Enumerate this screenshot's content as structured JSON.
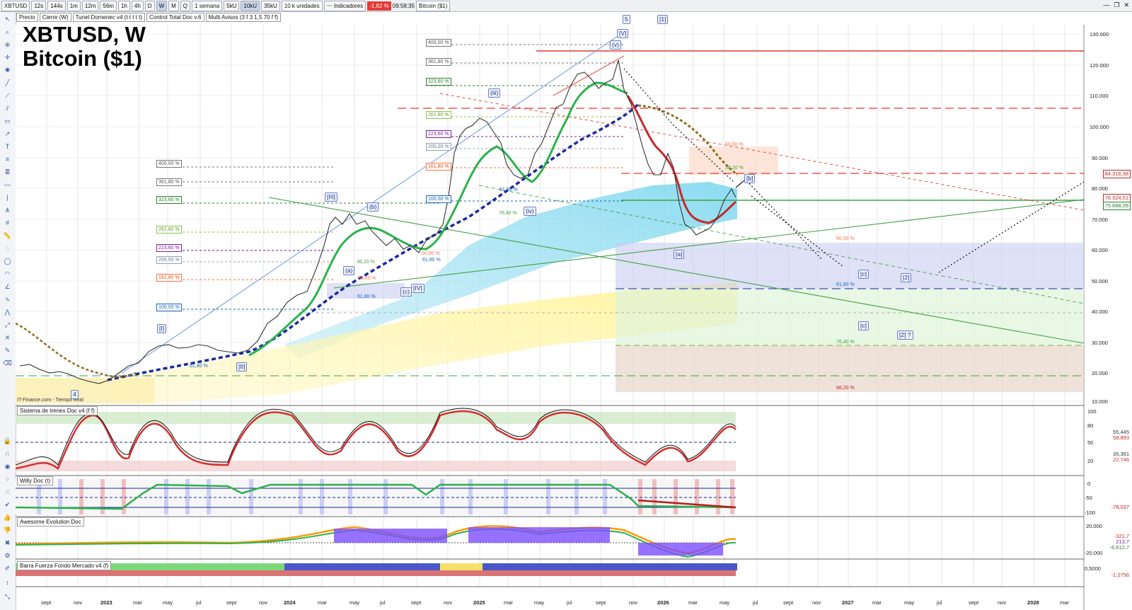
{
  "toolbar": {
    "symbol": "XBTUSD",
    "intervals": [
      "12s",
      "144s",
      "1m",
      "12m",
      "56m",
      "1h",
      "4h",
      "D",
      "W",
      "M",
      "Q"
    ],
    "active_interval": "W",
    "range": "1 semana",
    "units": [
      "5kU",
      "10kU",
      "35kU"
    ],
    "active_unit": "10kU",
    "unit_count": "10 k unidades",
    "indicators_label": "Indicadores",
    "change": "-1,82 %",
    "time": "09:58:35",
    "instrument": "Bitcoin ($1)"
  },
  "legend": [
    "Precio",
    "Cierre (W)",
    "Tunel Domenec v4 (t t t t t)",
    "Control Total Doc v.6",
    "Multi Avisos (3 f 3 1,5 70 f f)"
  ],
  "title": {
    "line1": "XBTUSD, W",
    "line2": "Bitcoin ($1)"
  },
  "source_note": "IT-Finance.com - Tiempo Real",
  "price_axis": [
    "130.000",
    "120.000",
    "110.000",
    "100.000",
    "90.000",
    "80.000",
    "70.000",
    "60.000",
    "50.000",
    "40.000",
    "30.000",
    "20.000",
    "10.000"
  ],
  "price_tags": [
    {
      "text": "84.316,38",
      "color": "#c62828",
      "bg": "#ffffff"
    },
    {
      "text": "76.324,51",
      "color": "#c62828",
      "bg": "#ffffff"
    },
    {
      "text": "75.688,09",
      "color": "#2e7d32",
      "bg": "#ffffff"
    }
  ],
  "time_axis": [
    "sept",
    "nov",
    "2023",
    "mar",
    "may",
    "jul",
    "sept",
    "nov",
    "2024",
    "mar",
    "may",
    "jul",
    "sept",
    "nov",
    "2025",
    "mar",
    "may",
    "jul",
    "sept",
    "nov",
    "2026",
    "mar",
    "may",
    "jul",
    "sept",
    "nov",
    "2027",
    "mar",
    "may",
    "jul",
    "sept",
    "nov",
    "2028",
    "mar"
  ],
  "waves": [
    "[1]",
    "5",
    "[V]",
    "(v)",
    "(iii)",
    "(iv)",
    "[III]",
    "(b)",
    "(a)",
    "(c)",
    "[IV]",
    "[I]",
    "[II]",
    "4",
    "[a]",
    "[b]",
    "[c]",
    "[2]",
    "[c]",
    "[2] ?"
  ],
  "fib_left": [
    "400,00 %",
    "361,80 %",
    "323,60 %",
    "261,80 %",
    "223,60 %",
    "200,00 %",
    "161,80 %",
    "100,00 %"
  ],
  "fib_mid": [
    "400,00 %",
    "361,80 %",
    "323,60 %",
    "261,80 %",
    "223,60 %",
    "200,00 %",
    "161,80 %",
    "100,00 %"
  ],
  "retrace_labels": [
    "38,20 %",
    "50,00 %",
    "61,80 %",
    "61,80 %",
    "50,00 %",
    "61,80 %",
    "76,40 %",
    "50,00 %",
    "61,80 %",
    "76,40 %",
    "88,20 %",
    "50,00 %",
    "38,20 %",
    "61,80 %"
  ],
  "panels": [
    {
      "label": "Sistema de trenes Doc v4 (f f)",
      "axis": [
        "100",
        "80",
        "50",
        "20"
      ],
      "tags": [
        "55,445",
        "58,893",
        "35,391",
        "22,746"
      ]
    },
    {
      "label": "Willy Doc (t)",
      "axis": [
        "0",
        "-50",
        "-100"
      ],
      "tags": [
        "-78,037"
      ]
    },
    {
      "label": "Awesome Evolution Doc",
      "axis": [
        "20.000",
        "-20.000"
      ],
      "tags": [
        "-321,7",
        "213,7",
        "-6.612,7"
      ]
    },
    {
      "label": "Barra Fuerza Fondo Mercado v4 (f)",
      "axis": [
        "0,5000"
      ],
      "tags": [
        "-1,2756"
      ]
    }
  ],
  "colors": {
    "up": "#2e7d32",
    "down": "#c62828",
    "accent": "#1565c0"
  }
}
